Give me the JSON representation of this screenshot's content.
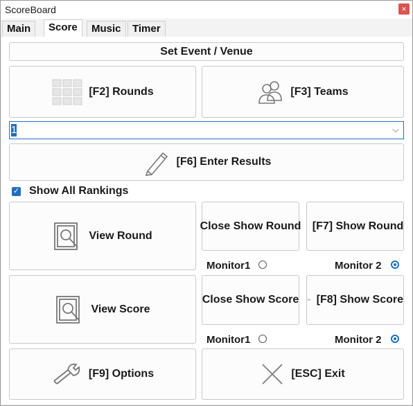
{
  "window": {
    "title": "ScoreBoard",
    "close_label": "×"
  },
  "tabs": [
    {
      "label": "Main"
    },
    {
      "label": "Score"
    },
    {
      "label": "Music"
    },
    {
      "label": "Timer"
    }
  ],
  "active_tab": "Score",
  "buttons": {
    "set_event": "Set Event / Venue",
    "rounds": "[F2] Rounds",
    "teams": "[F3] Teams",
    "enter_results": "[F6] Enter Results",
    "view_round": "View Round",
    "close_show_round": "Close\nShow\nRound",
    "show_round": "[F7]\nShow\nRound",
    "view_score": "View Score",
    "close_show_score": "Close\nShow\nScore",
    "show_score": "[F8]\nShow\nScore",
    "options": "[F9] Options",
    "exit": "[ESC] Exit"
  },
  "round_select": {
    "value": "1",
    "chevron": "⌵"
  },
  "show_all_rankings": {
    "label": "Show All Rankings",
    "checked": true,
    "check_glyph": "✓"
  },
  "round_monitors": {
    "monitor1": "Monitor1",
    "monitor2": "Monitor 2",
    "selected": "Monitor 2"
  },
  "score_monitors": {
    "monitor1": "Monitor1",
    "monitor2": "Monitor 2",
    "selected": "Monitor 2"
  },
  "colors": {
    "accent": "#1f6fbf",
    "close": "#d9534f"
  },
  "icons": {
    "rounds": "grid-icon",
    "teams": "people-icon",
    "enter_results": "pencil-icon",
    "view_round": "magnifier-icon",
    "show_round": "eye-icon",
    "view_score": "magnifier-icon",
    "show_score": "eye-icon",
    "options": "wrench-icon",
    "exit": "x-icon"
  }
}
